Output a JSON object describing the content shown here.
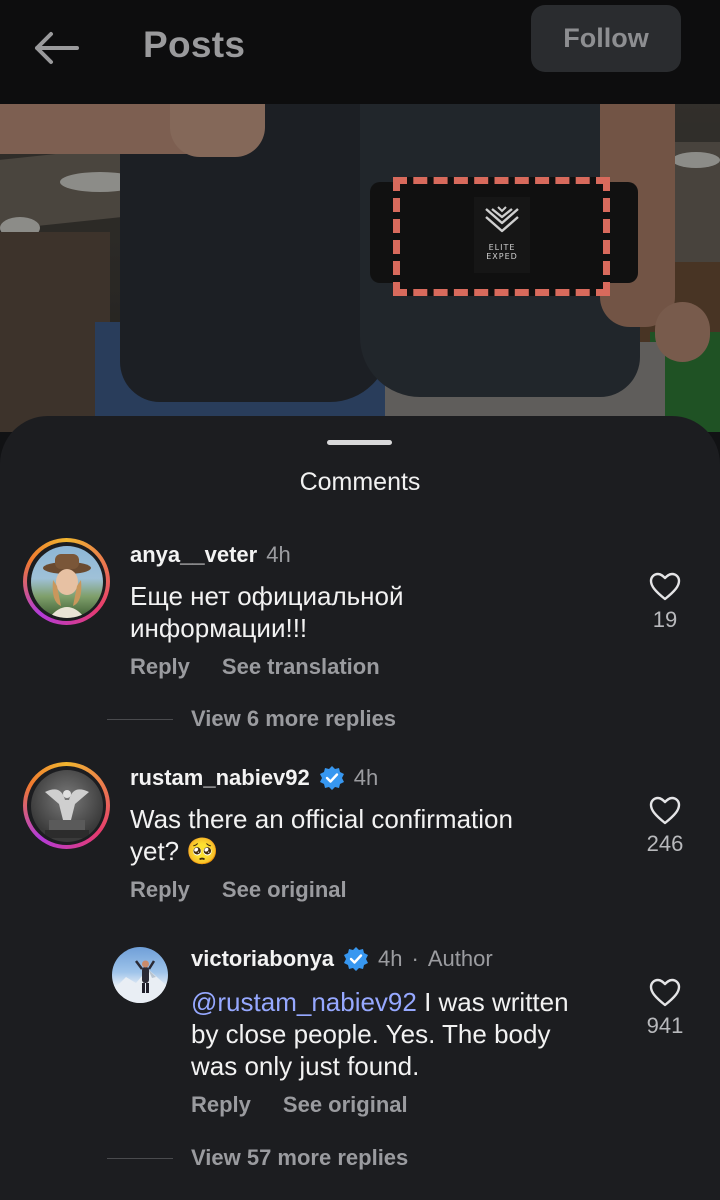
{
  "header": {
    "title": "Posts",
    "follow_label": "Follow"
  },
  "post": {
    "patch_logo_text_1": "ELITE",
    "patch_logo_text_2": "EXPED"
  },
  "comments_sheet": {
    "title": "Comments",
    "comments": [
      {
        "username": "anya__veter",
        "time": "4h",
        "verified": false,
        "text_line_1": "Еще нет официальной",
        "text_line_2": "информации!!!",
        "likes": "19",
        "reply_label": "Reply",
        "translate_label": "See translation",
        "view_more": "View 6 more replies"
      },
      {
        "username": "rustam_nabiev92",
        "time": "4h",
        "verified": true,
        "text_line_1": "Was there an official confirmation",
        "text_line_2": "yet? 🥺",
        "likes": "246",
        "reply_label": "Reply",
        "translate_label": "See original"
      }
    ],
    "reply": {
      "username": "victoriabonya",
      "time": "4h",
      "dot": "·",
      "author_label": "Author",
      "verified": true,
      "mention": "@rustam_nabiev92",
      "text_line_1_rest": " I was written",
      "text_line_2": "by close people. Yes. The body",
      "text_line_3": "was only just found.",
      "likes": "941",
      "reply_label": "Reply",
      "translate_label": "See original",
      "view_more": "View 57 more replies"
    }
  },
  "colors": {
    "sheet_bg": "#1c1d20",
    "mention": "#96a8ff",
    "verified": "#3797f0"
  }
}
